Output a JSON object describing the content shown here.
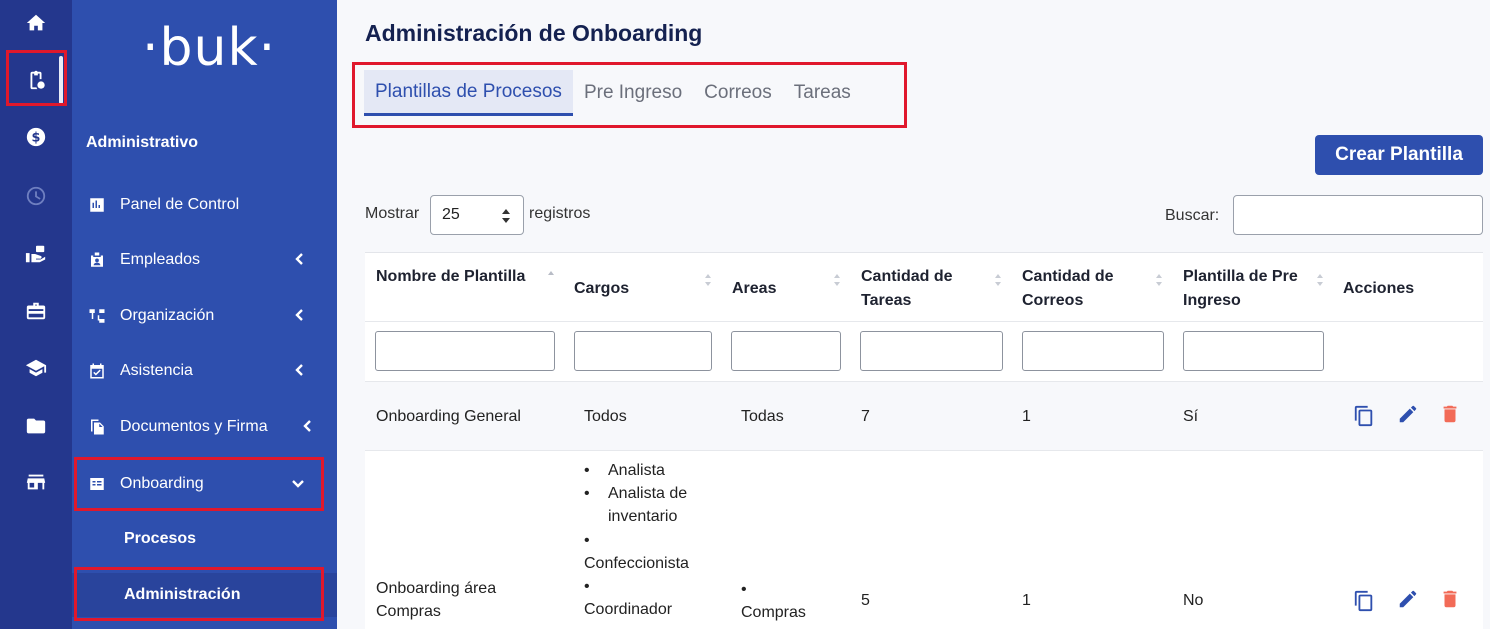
{
  "rail": {
    "items": [
      {
        "icon": "home-icon"
      },
      {
        "icon": "clipboard-icon",
        "active": true
      },
      {
        "icon": "dollar-icon"
      },
      {
        "icon": "clock-icon"
      },
      {
        "icon": "hand-money-icon"
      },
      {
        "icon": "briefcase-icon"
      },
      {
        "icon": "graduation-cap-icon"
      },
      {
        "icon": "folder-icon"
      },
      {
        "icon": "store-icon"
      }
    ]
  },
  "sidebar": {
    "logo": "·buk·",
    "section_title": "Administrativo",
    "items": [
      {
        "label": "Panel de Control",
        "icon": "chart-icon"
      },
      {
        "label": "Empleados",
        "icon": "id-badge-icon"
      },
      {
        "label": "Organización",
        "icon": "org-chart-icon"
      },
      {
        "label": "Asistencia",
        "icon": "calendar-check-icon"
      },
      {
        "label": "Documentos y Firma",
        "icon": "documents-icon"
      },
      {
        "label": "Onboarding",
        "icon": "onboarding-card-icon"
      }
    ],
    "subitems": [
      {
        "label": "Procesos"
      },
      {
        "label": "Administración",
        "active": true
      }
    ]
  },
  "page": {
    "title": "Administración de Onboarding",
    "tabs": [
      "Plantillas de Procesos",
      "Pre Ingreso",
      "Correos",
      "Tareas"
    ],
    "create_button": "Crear Plantilla"
  },
  "table_controls": {
    "show_label": "Mostrar",
    "page_size": "25",
    "records_label": "registros",
    "search_label": "Buscar:",
    "search_value": ""
  },
  "table": {
    "headers": [
      "Nombre de Plantilla",
      "Cargos",
      "Areas",
      "Cantidad de Tareas",
      "Cantidad de Correos",
      "Plantilla de Pre Ingreso",
      "Acciones"
    ],
    "rows": [
      {
        "name": "Onboarding General",
        "cargos": "Todos",
        "areas": "Todas",
        "tareas": "7",
        "correos": "1",
        "pre_ingreso": "Sí"
      },
      {
        "name": "Onboarding área Compras",
        "cargos_list": [
          "Analista",
          "Analista de inventario",
          "Confeccionista",
          "Coordinador"
        ],
        "areas_list": [
          "Compras"
        ],
        "tareas": "5",
        "correos": "1",
        "pre_ingreso": "No"
      }
    ]
  },
  "colors": {
    "rail_bg": "#24378d",
    "sidebar_bg": "#2e4fae",
    "accent": "#2e4fae",
    "highlight": "#e0182c",
    "delete": "#f26b57"
  }
}
